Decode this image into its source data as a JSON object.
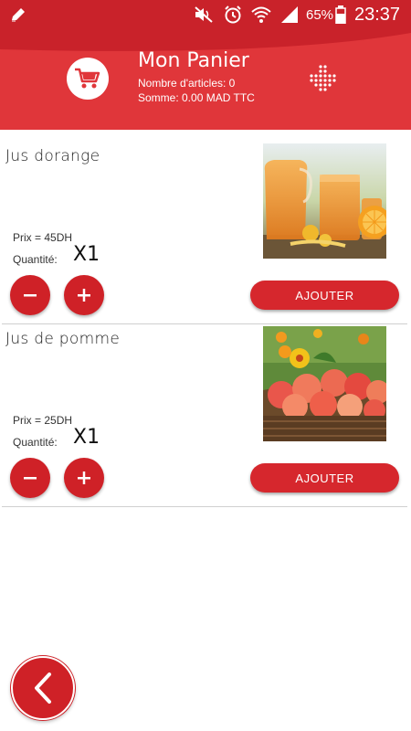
{
  "status_bar": {
    "battery_percent": "65%",
    "time": "23:37",
    "icons": [
      "pencil-icon",
      "mute-icon",
      "alarm-icon",
      "wifi-icon",
      "signal-icon",
      "battery-icon"
    ]
  },
  "header": {
    "title": "Mon Panier",
    "items_count_text": "Nombre d'articles: 0",
    "total_text": "Somme: 0.00 MAD TTC",
    "cart_icon": "cart-icon",
    "menu_icon": "dots-arrow-icon",
    "color": "#e0363a"
  },
  "products": [
    {
      "name": "Jus dorange",
      "price_text": "Prix = 45DH",
      "quantity_label": "Quantité:",
      "quantity_value": "X1",
      "add_label": "AJOUTER"
    },
    {
      "name": "Jus de pomme",
      "price_text": "Prix = 25DH",
      "quantity_label": "Quantité:",
      "quantity_value": "X1",
      "add_label": "AJOUTER"
    }
  ],
  "back_icon": "back-arrow-icon",
  "accent_color": "#cf2127"
}
